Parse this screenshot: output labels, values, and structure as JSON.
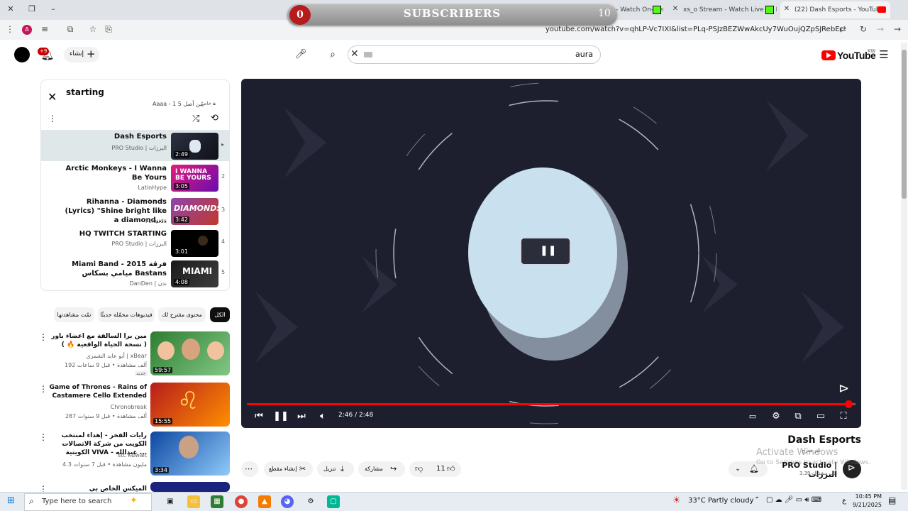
{
  "browser": {
    "tabs": [
      {
        "label": "Kwt3li Videos - Watch On-Dem"
      },
      {
        "label": "xs_o Stream - Watch Live on Ki"
      },
      {
        "label": "(22) Dash Esports - YouTube"
      }
    ],
    "url": "youtube.com/watch?v=qhLP-Vc7IXI&list=PLq-PSJzBEZWwAkcUy7WuOujQZpSJRebEc"
  },
  "overlay": {
    "count_left": "0",
    "label": "SUBSCRIBERS",
    "count_right": "10"
  },
  "header": {
    "notif_badge": "+9",
    "create_label": "إنشاء",
    "search_value": "aura",
    "logo_text": "YouTube",
    "region": "KW"
  },
  "playlist": {
    "title": "starting",
    "meta": "Aaaa - 1 من أصل 5",
    "privacy": "خاصّ",
    "items": [
      {
        "title": "Dash Esports",
        "channel": "PRO Studio | البرزات",
        "duration": "2:49",
        "index": "▸"
      },
      {
        "title": "Arctic Monkeys - I Wanna Be Yours",
        "channel": "LatinHype",
        "duration": "3:05",
        "index": "2"
      },
      {
        "title": "Rihanna - Diamonds (Lyrics) \"Shine bright like a diamond,...",
        "channel": "7clouds",
        "duration": "3:42",
        "index": "3"
      },
      {
        "title": "HQ TWITCH STARTING",
        "channel": "PRO Studio | البرزات",
        "duration": "3:01",
        "index": "4"
      },
      {
        "title": "Miami Band - 2015 فرقة ميامي بسكاس Bastans",
        "channel": "DanDen | ندن",
        "duration": "4:08",
        "index": "5"
      }
    ]
  },
  "chips": [
    {
      "label": "الكل"
    },
    {
      "label": "محتوى مقترح لك"
    },
    {
      "label": "فيديوهات محمّلة حديثًا"
    },
    {
      "label": "تمّت مشاهدتها"
    }
  ],
  "recommendations": [
    {
      "title": "مين برا السالفة مع اعضاء باور ( نسخة الحياة الواقعية 🔥 )",
      "channel": "أبو عابد الشمري | xBear",
      "meta": "192 ألف مشاهدة • قبل 9 ساعات",
      "badge": "جديد",
      "duration": "59:57"
    },
    {
      "title": "Game of Thrones - Rains of Castamere Cello Extended",
      "channel": "Chronobreak",
      "meta": "287 ألف مشاهدة • قبل 9 سنوات",
      "duration": "15:55"
    },
    {
      "title": "رايات الفخر - إهداء لمنتخب الكويت من شركة الاتصالات الكويتية VIVA - عبدالله ...",
      "channel": "stc Kuwait",
      "meta": "4.3 مليون مشاهدة • قبل 7 سنوات",
      "duration": "3:34"
    },
    {
      "title": "الميكس الخاص بي",
      "channel": "",
      "meta": "",
      "duration": ""
    }
  ],
  "player": {
    "time": "2:46 / 2:48",
    "progress": 0.988
  },
  "video": {
    "title": "Dash Esports",
    "channel": "PRO Studio | البرزات",
    "subs": "3.39 ألف مشترك",
    "like_count": "11",
    "share_label": "مشاركة",
    "download_label": "تنزيل",
    "clip_label": "إنشاء مقطع",
    "premiere": "غير مدرج"
  },
  "watermark": {
    "line1": "Activate Windows",
    "line2": "Go to Settings to activate Windows."
  },
  "taskbar": {
    "search_placeholder": "Type here to search",
    "weather": "33°C  Partly cloudy",
    "time": "10:45 PM",
    "date": "9/21/2025",
    "lang": "ع"
  },
  "colors": {
    "accent": "#ff0000",
    "player_bg": "#1e1f2e"
  }
}
